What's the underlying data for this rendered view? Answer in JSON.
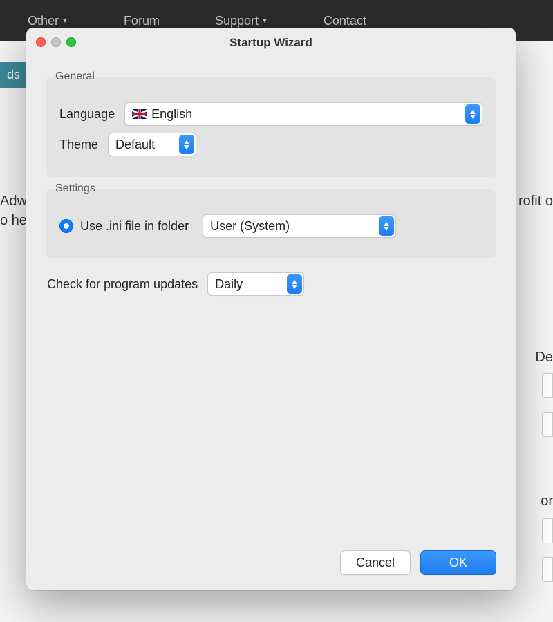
{
  "background": {
    "nav": {
      "other": "Other",
      "forum": "Forum",
      "support": "Support",
      "contact": "Contact"
    },
    "tag_left": "ds",
    "text_left1": "Adw",
    "text_left2": "o he",
    "text_right1": "rofit o",
    "text_right2": "De",
    "text_right3": "or"
  },
  "dialog": {
    "title": "Startup Wizard",
    "general": {
      "legend": "General",
      "language_label": "Language",
      "language_value": "English",
      "language_flag": "uk-flag-icon",
      "theme_label": "Theme",
      "theme_value": "Default"
    },
    "settings": {
      "legend": "Settings",
      "use_ini_label": "Use .ini file in folder",
      "use_ini_checked": true,
      "ini_location_value": "User (System)"
    },
    "updates": {
      "label": "Check for program updates",
      "value": "Daily"
    },
    "buttons": {
      "cancel": "Cancel",
      "ok": "OK"
    }
  }
}
